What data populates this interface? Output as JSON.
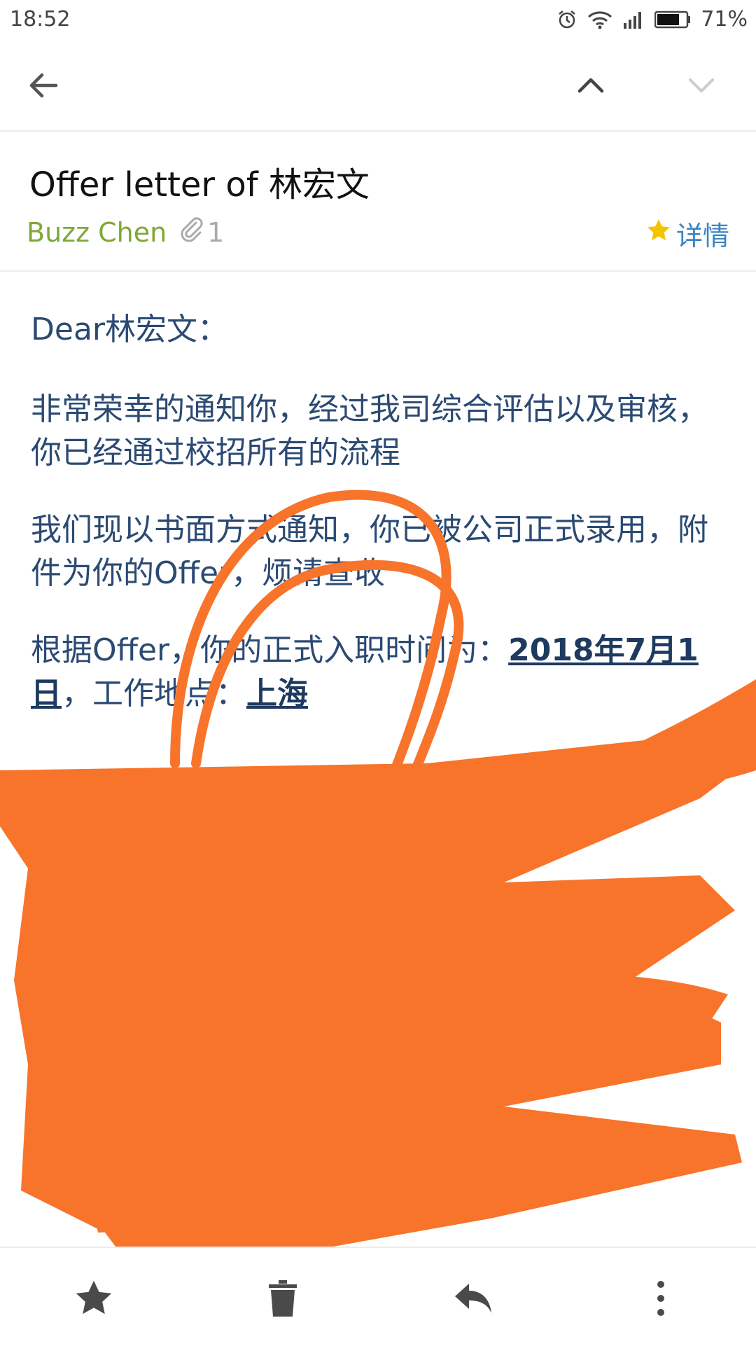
{
  "status": {
    "time": "18:52",
    "battery": "71%",
    "icons": [
      "alarm-icon",
      "wifi-icon",
      "signal-icon",
      "battery-icon"
    ]
  },
  "toolbar": {
    "icons": [
      "back-arrow-icon",
      "chevron-up-icon",
      "chevron-down-icon"
    ]
  },
  "email": {
    "subject": "Offer letter of 林宏文",
    "sender": "Buzz Chen",
    "attachment_count": "1",
    "details_label": "详情",
    "body": {
      "greeting": "Dear林宏文：",
      "para1": "非常荣幸的通知你，经过我司综合评估以及审核，你已经通过校招所有的流程",
      "para2": "我们现以书面方式通知，你已被公司正式录用，附件为你的Offer，烦请查收",
      "para3_prefix": "根据Offer，你的正式入职时间为：",
      "start_date": "2018年7月1日",
      "para3_mid": "，工作地点：",
      "location": "上海"
    }
  },
  "bottom_actions": [
    "star-icon",
    "trash-icon",
    "reply-icon",
    "more-vert-icon"
  ],
  "colors": {
    "sender": "#7fa838",
    "details": "#3b84c4",
    "body_text": "#2b4a73",
    "scribble": "#f7742a"
  }
}
